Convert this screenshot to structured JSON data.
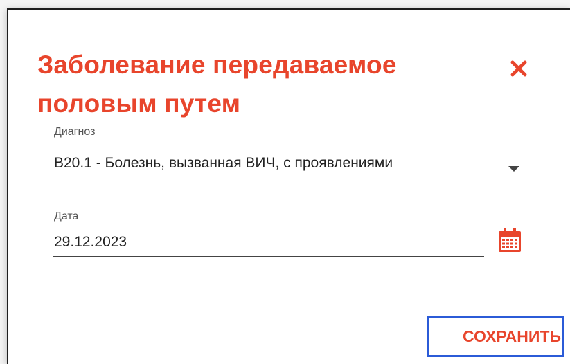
{
  "dialog": {
    "title": "Заболевание передаваемое половым путем",
    "close_icon": "close-icon",
    "accent_color": "#e8452c",
    "focus_color": "#2b5bd7"
  },
  "fields": {
    "diagnosis": {
      "label": "Диагноз",
      "value": "B20.1 - Болезнь, вызванная ВИЧ, с проявлениями",
      "icon": "chevron-down-icon"
    },
    "date": {
      "label": "Дата",
      "value": "29.12.2023",
      "icon": "calendar-icon"
    }
  },
  "actions": {
    "save_label": "СОХРАНИТЬ"
  }
}
